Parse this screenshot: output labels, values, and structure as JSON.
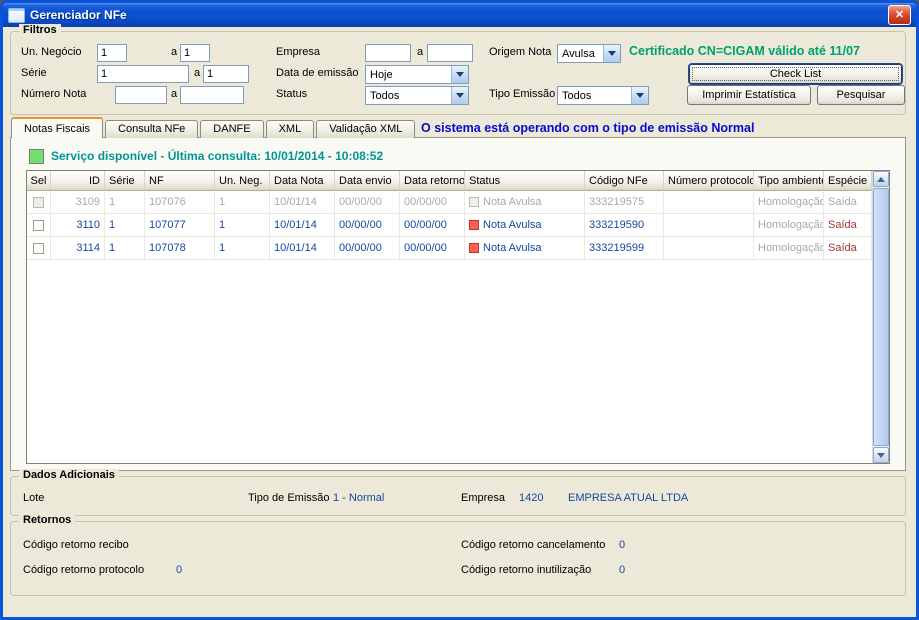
{
  "window": {
    "title": "Gerenciador NFe",
    "close": "✕"
  },
  "colors": {
    "titlebar_blue": "#0C4FCE",
    "window_bg": "#ECE9D8",
    "certificate_green": "#00A070",
    "service_teal": "#009595",
    "emission_blue": "#0909CF",
    "data_navy": "#16479E",
    "status_red_square": "#FF5F50",
    "service_green_square": "#6FE06F",
    "disabled_gray": "#A9A9A3",
    "especie_red": "#A03434"
  },
  "filters": {
    "legend": "Filtros",
    "sep": "a",
    "un_negocio_label": "Un. Negócio",
    "un_negocio_from": "1",
    "un_negocio_to": "1",
    "serie_label": "Série",
    "serie_from": "1",
    "serie_to": "1",
    "numero_nota_label": "Número Nota",
    "numero_nota_from": "",
    "numero_nota_to": "",
    "empresa_label": "Empresa",
    "empresa_from": "",
    "empresa_to": "",
    "data_emissao_label": "Data de emissão",
    "data_emissao_value": "Hoje",
    "status_label": "Status",
    "status_value": "Todos",
    "origem_nota_label": "Origem Nota",
    "origem_nota_value": "Avulsa",
    "tipo_emissao_label": "Tipo Emissão",
    "tipo_emissao_value": "Todos",
    "certificado": "Certificado CN=CIGAM válido até 11/07",
    "check_list": "Check List",
    "imprimir_estatistica": "Imprimir Estatística",
    "pesquisar": "Pesquisar"
  },
  "tabs": [
    "Notas Fiscais",
    "Consulta NFe",
    "DANFE",
    "XML",
    "Validação XML"
  ],
  "emission_notice": "O sistema está operando com o tipo de emissão Normal",
  "service_status": "Serviço disponível - Última consulta: 10/01/2014 - 10:08:52",
  "table": {
    "columns": [
      "Sel",
      "ID",
      "Série",
      "NF",
      "Un. Neg.",
      "Data Nota",
      "Data envio",
      "Data retorno",
      "Status",
      "Código NFe",
      "Número protocolo",
      "Tipo ambiente",
      "Espécie"
    ],
    "rows": [
      {
        "id": "3109",
        "serie": "1",
        "nf": "107076",
        "un_neg": "1",
        "data_nota": "10/01/14",
        "data_envio": "00/00/00",
        "data_retorno": "00/00/00",
        "status": "Nota Avulsa",
        "codigo_nfe": "333219575",
        "numero_protocolo": "",
        "tipo_ambiente": "Homologação",
        "especie": "Saída"
      },
      {
        "id": "3110",
        "serie": "1",
        "nf": "107077",
        "un_neg": "1",
        "data_nota": "10/01/14",
        "data_envio": "00/00/00",
        "data_retorno": "00/00/00",
        "status": "Nota Avulsa",
        "codigo_nfe": "333219590",
        "numero_protocolo": "",
        "tipo_ambiente": "Homologação",
        "especie": "Saída"
      },
      {
        "id": "3114",
        "serie": "1",
        "nf": "107078",
        "un_neg": "1",
        "data_nota": "10/01/14",
        "data_envio": "00/00/00",
        "data_retorno": "00/00/00",
        "status": "Nota Avulsa",
        "codigo_nfe": "333219599",
        "numero_protocolo": "",
        "tipo_ambiente": "Homologação",
        "especie": "Saída"
      }
    ]
  },
  "dados_adicionais": {
    "legend": "Dados Adicionais",
    "lote_label": "Lote",
    "tipo_emissao_label": "Tipo de Emissão",
    "tipo_emissao_value": "1 - Normal",
    "empresa_label": "Empresa",
    "empresa_codigo": "1420",
    "empresa_nome": "EMPRESA ATUAL LTDA"
  },
  "retornos": {
    "legend": "Retornos",
    "recibo_label": "Código retorno recibo",
    "protocolo_label": "Código retorno protocolo",
    "protocolo_value": "0",
    "cancelamento_label": "Código retorno cancelamento",
    "cancelamento_value": "0",
    "inutilizacao_label": "Código retorno inutilização",
    "inutilizacao_value": "0"
  }
}
